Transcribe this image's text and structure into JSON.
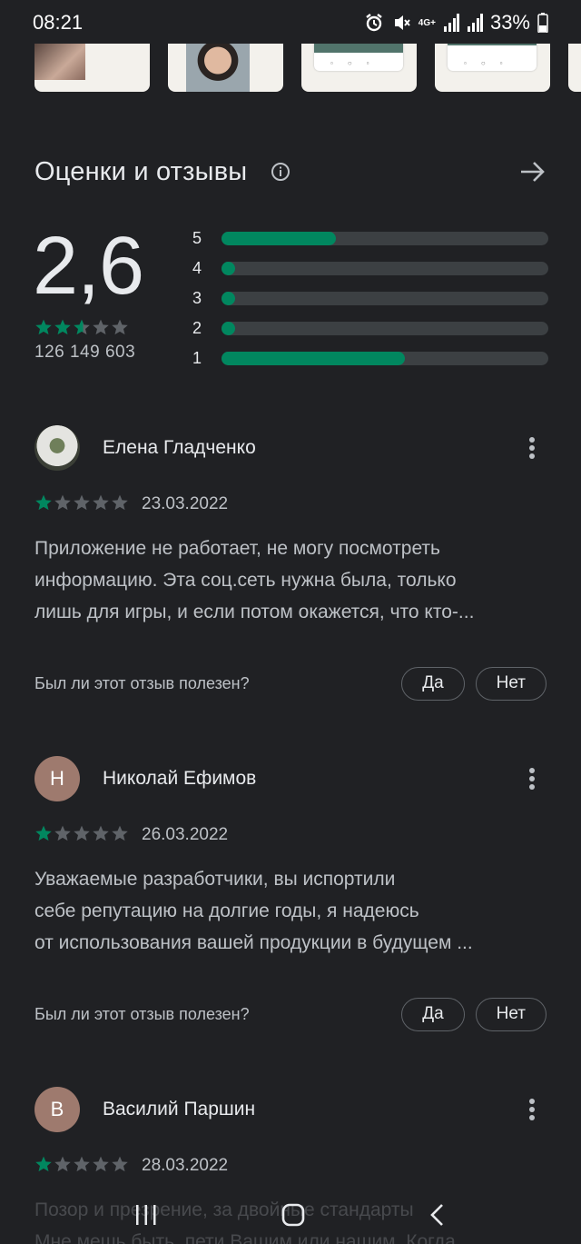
{
  "status_bar": {
    "time": "08:21",
    "network": "4G+",
    "battery": "33%",
    "icons": [
      "alarm-icon",
      "mute-icon",
      "signal-icon",
      "signal-icon",
      "battery-icon"
    ]
  },
  "section": {
    "title": "Оценки и отзывы",
    "info_icon": "info-icon",
    "arrow_icon": "arrow-right-icon"
  },
  "rating": {
    "average": "2,6",
    "stars_value": 2.6,
    "count": "126 149 603",
    "distribution": [
      {
        "label": "5",
        "fraction": 0.35
      },
      {
        "label": "4",
        "fraction": 0.02
      },
      {
        "label": "3",
        "fraction": 0.02
      },
      {
        "label": "2",
        "fraction": 0.02
      },
      {
        "label": "1",
        "fraction": 0.56
      }
    ]
  },
  "reviews": [
    {
      "name": "Елена Гладченко",
      "avatar": "photo",
      "avatar_letter": "",
      "stars": 1,
      "date": "23.03.2022",
      "lines": [
        "Приложение не работает, не могу посмотреть",
        "информацию. Эта соц.сеть нужна была, только",
        "лишь для игры, и если потом окажется, что кто-..."
      ],
      "helpful_question": "Был ли этот отзыв полезен?",
      "yes_label": "Да",
      "no_label": "Нет"
    },
    {
      "name": "Николай Ефимов",
      "avatar": "letter",
      "avatar_letter": "Н",
      "stars": 1,
      "date": "26.03.2022",
      "lines": [
        "Уважаемые разработчики, вы испортили",
        "себе репутацию на долгие годы, я надеюсь",
        "от использования вашей продукции в будущем ..."
      ],
      "helpful_question": "Был ли этот отзыв полезен?",
      "yes_label": "Да",
      "no_label": "Нет"
    },
    {
      "name": "Василий Паршин",
      "avatar": "letter",
      "avatar_letter": "В",
      "stars": 1,
      "date": "28.03.2022",
      "lines": [
        "Позор и презрение, за двойные стандарты",
        "Мне мешь быть, пети Вашим или нашим. Когда"
      ],
      "helpful_question": "",
      "yes_label": "",
      "no_label": ""
    }
  ],
  "navbar": {
    "recent_icon": "recent-apps-icon",
    "home_icon": "home-icon",
    "back_icon": "back-icon"
  },
  "colors": {
    "background": "#202124",
    "accent": "#01875f",
    "track": "#3c4043",
    "star_empty": "#5f6368"
  }
}
